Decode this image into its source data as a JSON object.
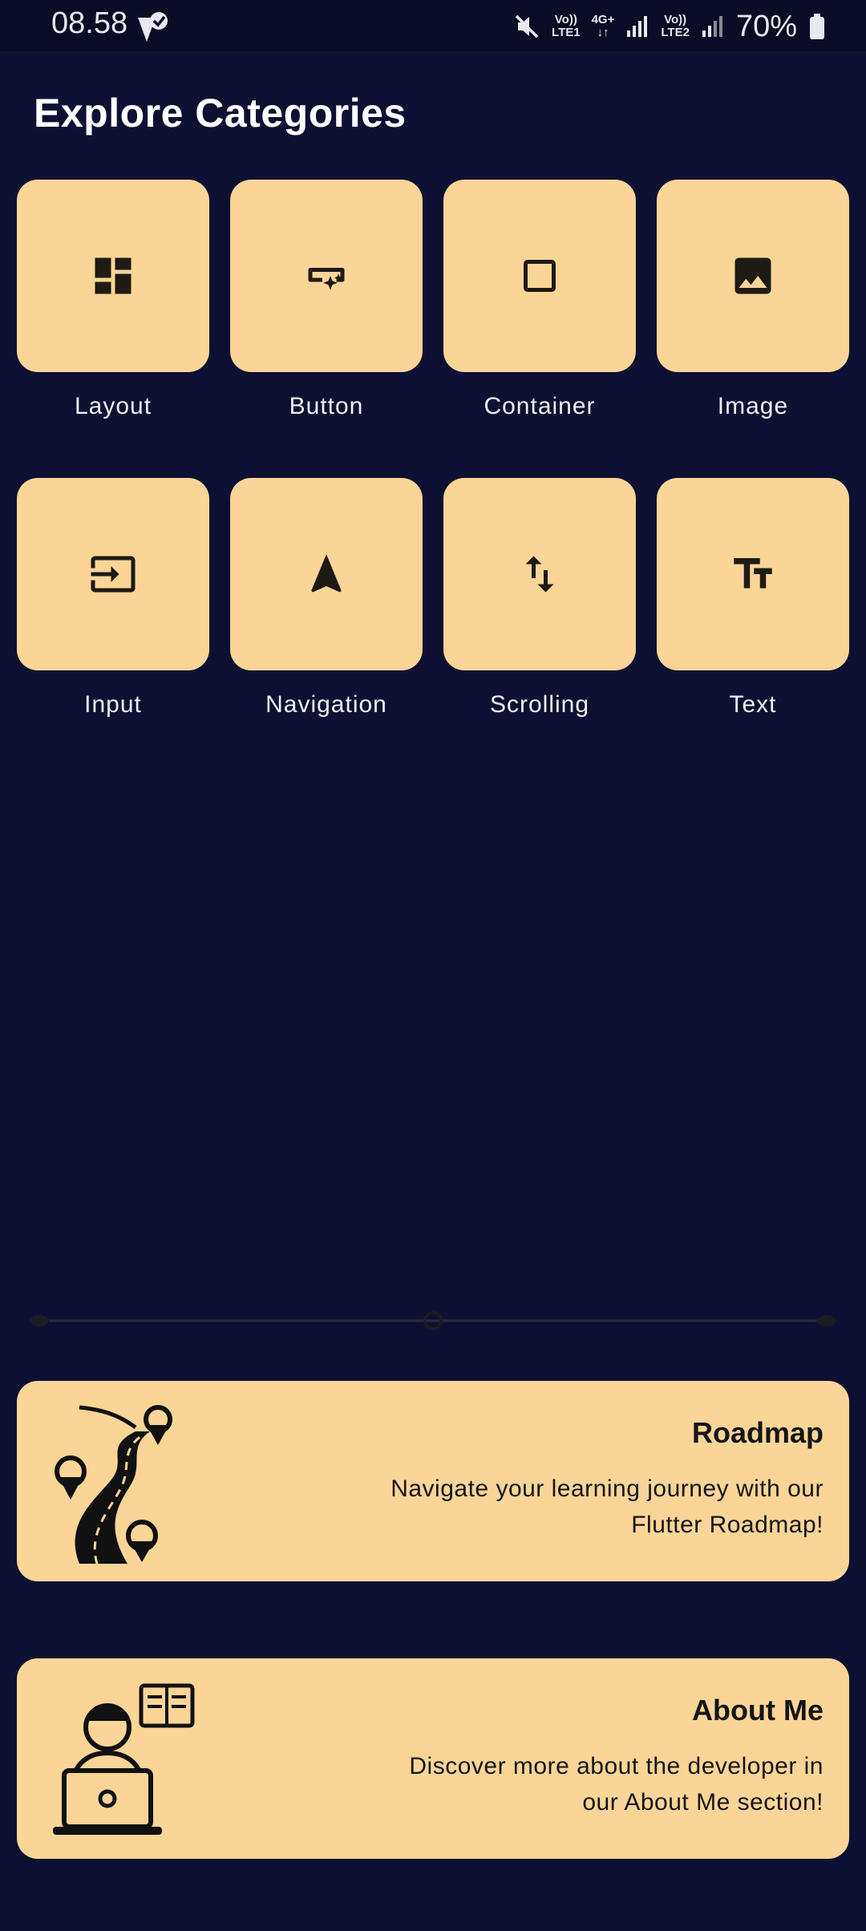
{
  "status_bar": {
    "time": "08.58",
    "net1_top": "Vo))",
    "net1_bottom": "LTE1",
    "net_type": "4G+",
    "net2_top": "Vo))",
    "net2_bottom": "LTE2",
    "battery": "70%"
  },
  "page": {
    "title": "Explore Categories"
  },
  "categories": [
    {
      "label": "Layout",
      "icon": "dashboard-icon"
    },
    {
      "label": "Button",
      "icon": "smart-button-icon"
    },
    {
      "label": "Container",
      "icon": "square-outline-icon"
    },
    {
      "label": "Image",
      "icon": "image-icon"
    },
    {
      "label": "Input",
      "icon": "input-icon"
    },
    {
      "label": "Navigation",
      "icon": "navigation-arrow-icon"
    },
    {
      "label": "Scrolling",
      "icon": "swap-vertical-icon"
    },
    {
      "label": "Text",
      "icon": "text-fields-icon"
    }
  ],
  "cards": {
    "roadmap": {
      "title": "Roadmap",
      "description": "Navigate your learning journey with our Flutter Roadmap!",
      "icon": "roadmap-illustration"
    },
    "about": {
      "title": "About Me",
      "description": "Discover more about the developer in our About Me section!",
      "icon": "developer-illustration"
    }
  },
  "colors": {
    "background": "#0e1033",
    "tile": "#fad597",
    "text_on_tile": "#141414"
  }
}
